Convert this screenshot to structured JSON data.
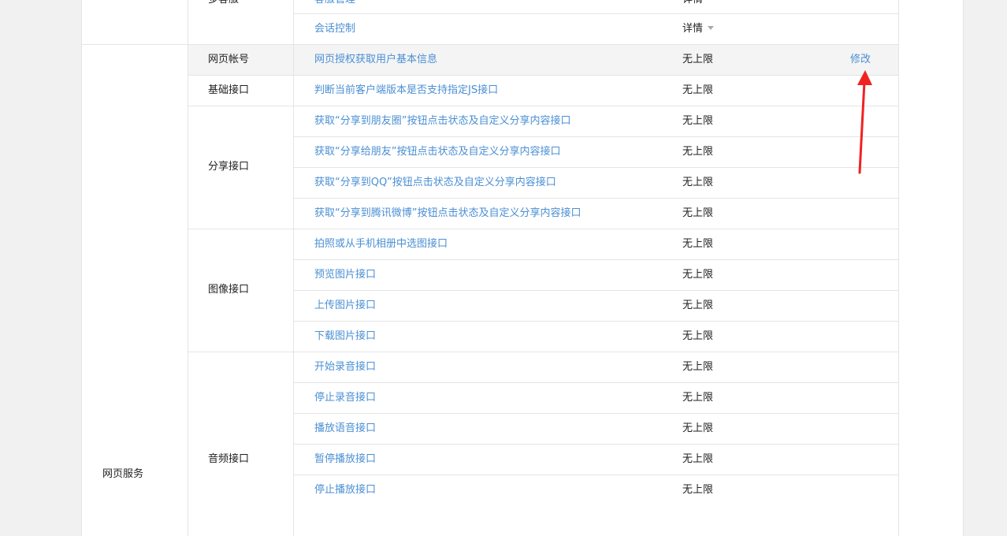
{
  "top_section": {
    "category": "多客服",
    "rows": [
      {
        "name": "客服管理",
        "limit": "详情"
      },
      {
        "name": "会话控制",
        "limit": "详情"
      }
    ]
  },
  "web_service": {
    "category": "网页服务",
    "groups": [
      {
        "name": "网页帐号",
        "rows": [
          {
            "name": "网页授权获取用户基本信息",
            "limit": "无上限",
            "action": "修改"
          }
        ]
      },
      {
        "name": "基础接口",
        "rows": [
          {
            "name": "判断当前客户端版本是否支持指定JS接口",
            "limit": "无上限"
          }
        ]
      },
      {
        "name": "分享接口",
        "rows": [
          {
            "name": "获取“分享到朋友圈”按钮点击状态及自定义分享内容接口",
            "limit": "无上限"
          },
          {
            "name": "获取“分享给朋友”按钮点击状态及自定义分享内容接口",
            "limit": "无上限"
          },
          {
            "name": "获取“分享到QQ”按钮点击状态及自定义分享内容接口",
            "limit": "无上限"
          },
          {
            "name": "获取“分享到腾讯微博”按钮点击状态及自定义分享内容接口",
            "limit": "无上限"
          }
        ]
      },
      {
        "name": "图像接口",
        "rows": [
          {
            "name": "拍照或从手机相册中选图接口",
            "limit": "无上限"
          },
          {
            "name": "预览图片接口",
            "limit": "无上限"
          },
          {
            "name": "上传图片接口",
            "limit": "无上限"
          },
          {
            "name": "下载图片接口",
            "limit": "无上限"
          }
        ]
      },
      {
        "name": "音频接口",
        "rows": [
          {
            "name": "开始录音接口",
            "limit": "无上限"
          },
          {
            "name": "停止录音接口",
            "limit": "无上限"
          },
          {
            "name": "播放语音接口",
            "limit": "无上限"
          },
          {
            "name": "暂停播放接口",
            "limit": "无上限"
          },
          {
            "name": "停止播放接口",
            "limit": "无上限"
          }
        ]
      }
    ]
  },
  "colors": {
    "link": "#4a8fd4",
    "annotation_arrow": "#f02222",
    "highlight_row": "#f4f4f4"
  }
}
